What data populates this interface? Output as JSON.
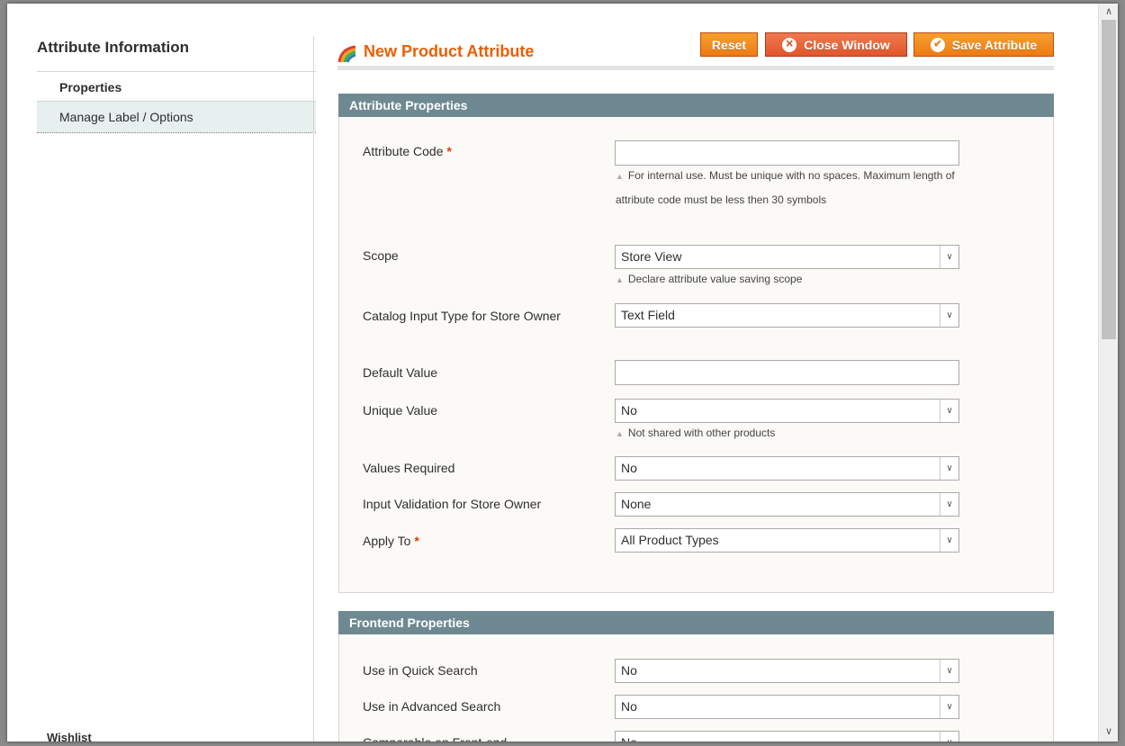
{
  "sidebar": {
    "title": "Attribute Information",
    "tabs": [
      {
        "label": "Properties"
      },
      {
        "label": "Manage Label / Options"
      }
    ]
  },
  "header": {
    "title": "New Product Attribute",
    "reset_label": "Reset",
    "close_label": "Close Window",
    "save_label": "Save Attribute"
  },
  "attribute_properties": {
    "heading": "Attribute Properties",
    "attribute_code": {
      "label": "Attribute Code",
      "value": "",
      "note": "For internal use. Must be unique with no spaces. Maximum length of attribute code must be less then 30 symbols"
    },
    "scope": {
      "label": "Scope",
      "value": "Store View",
      "note": "Declare attribute value saving scope"
    },
    "input_type": {
      "label": "Catalog Input Type for Store Owner",
      "value": "Text Field"
    },
    "default_value": {
      "label": "Default Value",
      "value": ""
    },
    "unique_value": {
      "label": "Unique Value",
      "value": "No",
      "note": "Not shared with other products"
    },
    "values_required": {
      "label": "Values Required",
      "value": "No"
    },
    "input_validation": {
      "label": "Input Validation for Store Owner",
      "value": "None"
    },
    "apply_to": {
      "label": "Apply To",
      "value": "All Product Types"
    }
  },
  "frontend_properties": {
    "heading": "Frontend Properties",
    "quick_search": {
      "label": "Use in Quick Search",
      "value": "No"
    },
    "advanced_search": {
      "label": "Use in Advanced Search",
      "value": "No"
    },
    "comparable": {
      "label": "Comparable on Front-end",
      "value": "No"
    }
  },
  "background_peek_text": "Wishlist",
  "colors": {
    "accent": "#eb5e00",
    "section_header": "#6f8992",
    "button": "#ed7a12"
  }
}
